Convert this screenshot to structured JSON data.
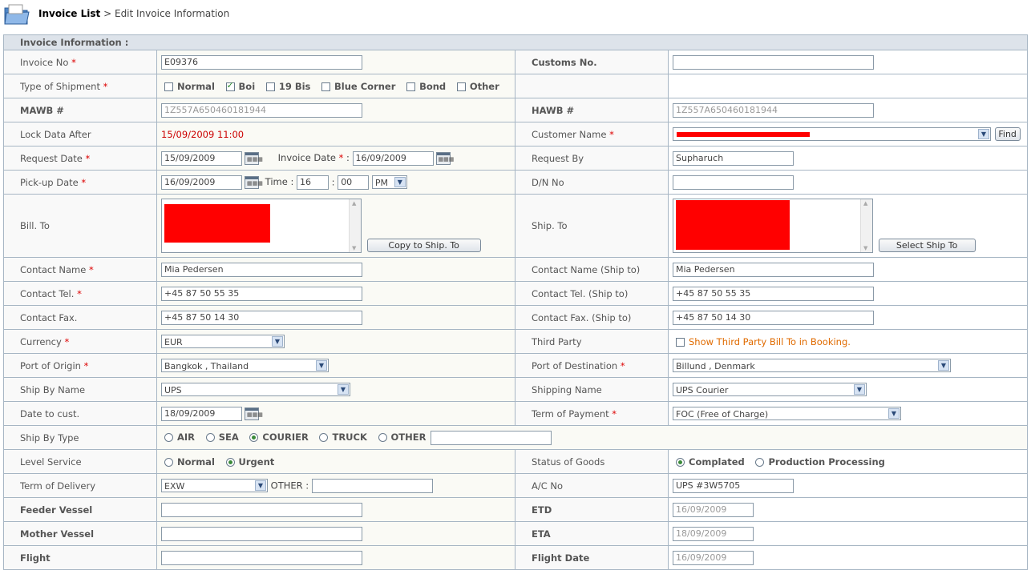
{
  "breadcrumb": {
    "parent": "Invoice List",
    "sep": ">",
    "current": "Edit Invoice Information"
  },
  "section_title": "Invoice Information :",
  "labels": {
    "invoice_no": "Invoice No",
    "customs_no": "Customs No.",
    "type_of_shipment": "Type of Shipment",
    "mawb": "MAWB #",
    "hawb": "HAWB #",
    "lock_data_after": "Lock Data After",
    "customer_name": "Customer Name",
    "request_date": "Request Date",
    "invoice_date": "Invoice Date",
    "request_by": "Request By",
    "pickup_date": "Pick-up Date",
    "time": "Time :",
    "dn_no": "D/N No",
    "bill_to": "Bill. To",
    "ship_to": "Ship. To",
    "contact_name": "Contact Name",
    "contact_name_ship": "Contact Name (Ship to)",
    "contact_tel": "Contact Tel.",
    "contact_tel_ship": "Contact Tel. (Ship to)",
    "contact_fax": "Contact Fax.",
    "contact_fax_ship": "Contact Fax. (Ship to)",
    "currency": "Currency",
    "third_party": "Third Party",
    "port_origin": "Port of Origin",
    "port_destination": "Port of Destination",
    "ship_by_name": "Ship By Name",
    "shipping_name": "Shipping Name",
    "date_to_cust": "Date to cust.",
    "term_of_payment": "Term of Payment",
    "ship_by_type": "Ship By Type",
    "level_service": "Level Service",
    "status_of_goods": "Status of Goods",
    "term_of_delivery": "Term of Delivery",
    "other": "OTHER :",
    "ac_no": "A/C No",
    "feeder_vessel": "Feeder Vessel",
    "etd": "ETD",
    "mother_vessel": "Mother Vessel",
    "eta": "ETA",
    "flight": "Flight",
    "flight_date": "Flight Date"
  },
  "values": {
    "invoice_no": "E09376",
    "customs_no": "",
    "mawb": "1Z557A650460181944",
    "hawb": "1Z557A650460181944",
    "lock_data_after": "15/09/2009 11:00",
    "request_date": "15/09/2009",
    "invoice_date": "16/09/2009",
    "request_by": "Supharuch",
    "pickup_date": "16/09/2009",
    "time_hour": "16",
    "time_min": "00",
    "time_ampm": "PM",
    "dn_no": "",
    "contact_name": "Mia Pedersen",
    "contact_name_ship": "Mia Pedersen",
    "contact_tel": "+45 87 50 55 35",
    "contact_tel_ship": "+45 87 50 55 35",
    "contact_fax": "+45 87 50 14 30",
    "contact_fax_ship": "+45 87 50 14 30",
    "currency": "EUR",
    "port_origin": "Bangkok , Thailand",
    "port_destination": "Billund , Denmark",
    "ship_by_name": "UPS",
    "shipping_name": "UPS Courier",
    "date_to_cust": "18/09/2009",
    "term_of_payment": "FOC (Free of Charge)",
    "ship_by_type_other": "",
    "term_of_delivery": "EXW",
    "term_of_delivery_other": "",
    "ac_no": "UPS #3W5705",
    "feeder_vessel": "",
    "etd": "16/09/2009",
    "mother_vessel": "",
    "eta": "18/09/2009",
    "flight": "",
    "flight_date": "16/09/2009"
  },
  "shipment_types": [
    {
      "label": "Normal",
      "checked": false
    },
    {
      "label": "Boi",
      "checked": true
    },
    {
      "label": "19 Bis",
      "checked": false
    },
    {
      "label": "Blue Corner",
      "checked": false
    },
    {
      "label": "Bond",
      "checked": false
    },
    {
      "label": "Other",
      "checked": false
    }
  ],
  "ship_by_types": [
    {
      "label": "AIR",
      "selected": false
    },
    {
      "label": "SEA",
      "selected": false
    },
    {
      "label": "COURIER",
      "selected": true
    },
    {
      "label": "TRUCK",
      "selected": false
    },
    {
      "label": "OTHER",
      "selected": false
    }
  ],
  "level_services": [
    {
      "label": "Normal",
      "selected": false
    },
    {
      "label": "Urgent",
      "selected": true
    }
  ],
  "status_goods": [
    {
      "label": "Complated",
      "selected": true
    },
    {
      "label": "Production Processing",
      "selected": false
    }
  ],
  "buttons": {
    "find": "Find",
    "copy_to_ship": "Copy to Ship. To",
    "select_ship_to": "Select Ship To"
  },
  "third_party_text": "Show Third Party Bill To in Booking.",
  "required_mark": "*",
  "icons": {
    "folder": "folder-icon",
    "calendar": "calendar-icon",
    "dropdown": "chevron-down-icon"
  }
}
